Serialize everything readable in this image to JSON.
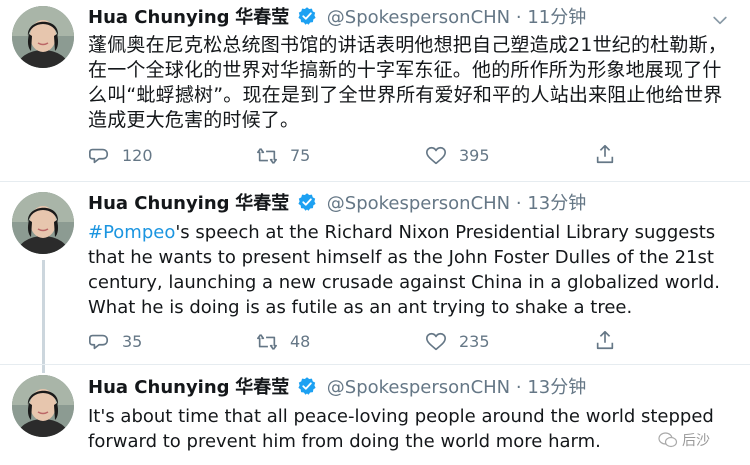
{
  "tweets": [
    {
      "name": "Hua Chunying",
      "name_zh": "华春莹",
      "handle": "@SpokespersonCHN",
      "separator": "·",
      "time": "11分钟",
      "text": "蓬佩奥在尼克松总统图书馆的讲话表明他想把自己塑造成21世纪的杜勒斯，在一个全球化的世界对华搞新的十字军东征。他的所作所为形象地展现了什么叫“蚍蜉撼树”。现在是到了全世界所有爱好和平的人站出来阻止他给世界造成更大危害的时候了。",
      "replies": "120",
      "retweets": "75",
      "likes": "395"
    },
    {
      "name": "Hua Chunying",
      "name_zh": "华春莹",
      "handle": "@SpokespersonCHN",
      "separator": "·",
      "time": "13分钟",
      "hashtag": "#Pompeo",
      "text": "'s speech at the Richard Nixon Presidential Library suggests that he wants to present himself as the John Foster Dulles of the 21st century, launching a new crusade against China in a globalized world. What he is doing is as futile as an ant trying to shake a tree.",
      "replies": "35",
      "retweets": "48",
      "likes": "235"
    },
    {
      "name": "Hua Chunying",
      "name_zh": "华春莹",
      "handle": "@SpokespersonCHN",
      "separator": "·",
      "time": "13分钟",
      "text": "It's about time that all peace-loving people around the world stepped forward to prevent him from doing the world more harm."
    }
  ],
  "watermark": {
    "label": "后沙"
  },
  "icons": {
    "verified": "verified-badge-icon",
    "reply": "reply-icon",
    "retweet": "retweet-icon",
    "like": "heart-icon",
    "share": "share-icon",
    "menu": "chevron-down-icon"
  },
  "colors": {
    "verified": "#1da1f2",
    "link": "#1b95e0",
    "muted": "#657786"
  }
}
